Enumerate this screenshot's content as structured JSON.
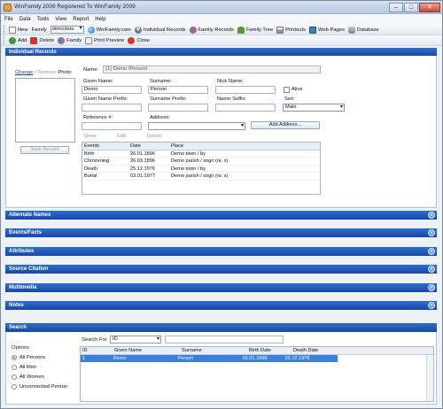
{
  "window": {
    "title": "WinFamily 2009 Registered To WinFamily 2009"
  },
  "menu": [
    "File",
    "Data",
    "Tools",
    "View",
    "Report",
    "Help"
  ],
  "toolbar1": {
    "new": "New",
    "family_label": "Family",
    "family_value": "demodata",
    "winfamily_com": "WinFamily.com",
    "individual_records": "Individual Records",
    "family_records": "Family Records",
    "family_tree": "Family Tree",
    "printouts": "Printouts",
    "web_pages": "Web Pages",
    "database": "Database"
  },
  "toolbar2": {
    "add": "Add",
    "delete": "Delete",
    "family": "Family",
    "print_preview": "Print Preview",
    "close": "Close"
  },
  "record": {
    "header": "Individual Records",
    "photo": {
      "change": "Change",
      "separator": "/",
      "remove": "Remove",
      "photo": "Photo"
    },
    "save_button": "Save Record",
    "name_label": "Name:",
    "name_value": "(1) Demo /Person/",
    "given_name_label": "Given Name:",
    "given_name_value": "Demo",
    "surname_label": "Surname:",
    "surname_value": "Person",
    "nick_name_label": "Nick Name:",
    "nick_name_value": "",
    "alive_label": "Alive",
    "given_prefix_label": "Given Name Prefix:",
    "surname_prefix_label": "Surname Prefix:",
    "name_suffix_label": "Name Suffix:",
    "sex_label": "Sex:",
    "sex_value": "Male",
    "ref_label": "Reference #:",
    "address_label": "Address:",
    "add_address_button": "Add Address...",
    "tabs": {
      "show": "Show",
      "edit": "Edit",
      "delete": "Delete"
    },
    "events_table": {
      "headers": [
        "Events",
        "Date",
        "Place"
      ],
      "rows": [
        [
          "Birth",
          "26.01.1896",
          "Demo town / by"
        ],
        [
          "Christening",
          "26.03.1896",
          "Demo parish / sogn (nr. x)"
        ],
        [
          "Death",
          "25.12.1976",
          "Demo town / by"
        ],
        [
          "Burial",
          "03.01.1977",
          "Demo parish / sogn (nr. x)"
        ]
      ]
    }
  },
  "sections": [
    "Alternate Names",
    "Events/Facts",
    "Attributes",
    "Source Citation",
    "Multimedia",
    "Notes"
  ],
  "search": {
    "header": "Search",
    "search_for_label": "Search For",
    "search_for_value": "ID",
    "search_text": "",
    "options_label": "Options",
    "options": [
      "All Persons",
      "All Men",
      "All Women",
      "Unconnected Person"
    ],
    "selected_option": "All Persons",
    "results": {
      "headers": [
        "ID",
        "Given Name",
        "Surname",
        "Birth Date",
        "Death Date"
      ],
      "rows": [
        [
          "1",
          "Demo",
          "Person",
          "26.01.1896",
          "25.12.1976"
        ]
      ]
    }
  }
}
